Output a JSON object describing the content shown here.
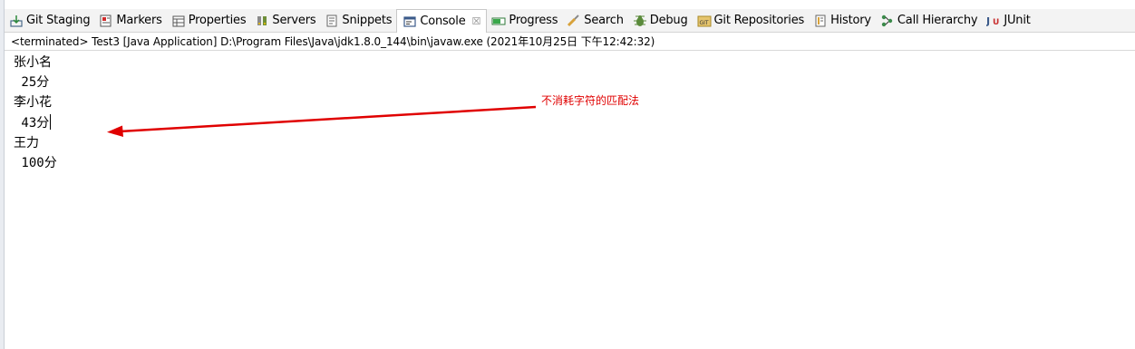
{
  "tabs": [
    {
      "label": "Git Staging",
      "icon": "git-staging-icon"
    },
    {
      "label": "Markers",
      "icon": "markers-icon"
    },
    {
      "label": "Properties",
      "icon": "properties-icon"
    },
    {
      "label": "Servers",
      "icon": "servers-icon"
    },
    {
      "label": "Snippets",
      "icon": "snippets-icon"
    },
    {
      "label": "Console",
      "icon": "console-icon",
      "active": true,
      "close": "☒"
    },
    {
      "label": "Progress",
      "icon": "progress-icon"
    },
    {
      "label": "Search",
      "icon": "search-icon"
    },
    {
      "label": "Debug",
      "icon": "debug-icon"
    },
    {
      "label": "Git Repositories",
      "icon": "git-repositories-icon"
    },
    {
      "label": "History",
      "icon": "history-icon"
    },
    {
      "label": "Call Hierarchy",
      "icon": "call-hierarchy-icon"
    },
    {
      "label": "JUnit",
      "icon": "junit-icon"
    }
  ],
  "console": {
    "status": "<terminated> Test3 [Java Application] D:\\Program Files\\Java\\jdk1.8.0_144\\bin\\javaw.exe (2021年10月25日 下午12:42:32)",
    "lines": [
      "张小名",
      " 25分",
      "李小花",
      " 43分",
      "王力",
      " 100分"
    ]
  },
  "annotation": {
    "text": "不消耗字符的匹配法",
    "color": "#e00000"
  },
  "colors": {
    "tab_bar": "#f3f3f3",
    "active_tab": "#ffffff",
    "annotation_arrow": "#e00000"
  }
}
